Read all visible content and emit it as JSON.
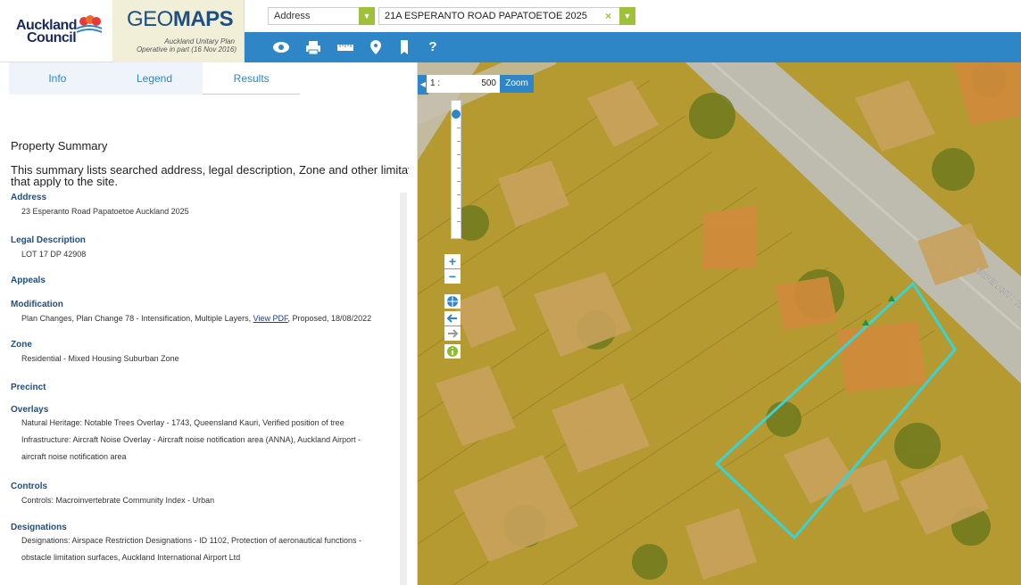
{
  "brand": {
    "council_line1": "Auckland",
    "council_line2": "Council",
    "geomaps_prefix": "GEO",
    "geomaps_suffix": "MAPS",
    "plan_line1": "Auckland Unitary Plan",
    "plan_line2": "Operative in part (16 Nov 2016)"
  },
  "search": {
    "type_value": "Address",
    "address_value": "21A ESPERANTO ROAD PAPATOETOE 2025",
    "clear_glyph": "×",
    "dropdown_glyph": "▼"
  },
  "toolbar": {
    "icons": [
      "eye-icon",
      "print-icon",
      "ruler-icon",
      "pin-icon",
      "bookmark-icon",
      "help-icon"
    ],
    "help_label": "?"
  },
  "tabs": [
    {
      "label": "Info"
    },
    {
      "label": "Legend"
    },
    {
      "label": "Results"
    }
  ],
  "summary": {
    "title": "Property Summary",
    "desc_line1": "This summary lists searched address, legal description, Zone and other limitatio",
    "desc_line2": "that apply to the site."
  },
  "sections": {
    "address": {
      "heading": "Address",
      "value": "23 Esperanto Road Papatoetoe Auckland 2025"
    },
    "legal": {
      "heading": "Legal Description",
      "value": "LOT 17 DP 42908"
    },
    "appeals": {
      "heading": "Appeals"
    },
    "modification": {
      "heading": "Modification",
      "prefix": "Plan Changes, Plan Change 78 - Intensification, Multiple Layers, ",
      "link": "View PDF",
      "suffix": ", Proposed, 18/08/2022"
    },
    "zone": {
      "heading": "Zone",
      "value": "Residential - Mixed Housing Suburban Zone"
    },
    "precinct": {
      "heading": "Precinct"
    },
    "overlays": {
      "heading": "Overlays",
      "line1": "Natural Heritage: Notable Trees Overlay - 1743, Queensland Kauri, Verified position of tree",
      "line2": "Infrastructure: Aircraft Noise Overlay - Aircraft noise notification area (ANNA), Auckland Airport -",
      "line3": "aircraft noise notification area"
    },
    "controls": {
      "heading": "Controls",
      "value": "Controls: Macroinvertebrate Community Index - Urban"
    },
    "designations": {
      "heading": "Designations",
      "line1": "Designations: Airspace Restriction Designations - ID 1102, Protection of aeronautical functions -",
      "line2": "obstacle limitation surfaces, Auckland International Airport Ltd"
    }
  },
  "map": {
    "scale_prefix": "1 :",
    "scale_value": "500",
    "zoom_label": "Zoom",
    "road_label": "ESPERANTO ROAD",
    "collapse_glyph": "◀",
    "zoom_in": "+",
    "zoom_out": "−",
    "parcel_color": "#39d3d6",
    "overlay_color": "#c9a53a"
  }
}
